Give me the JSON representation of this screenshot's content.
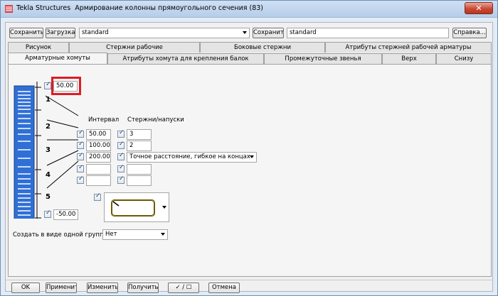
{
  "window": {
    "app_name": "Tekla Structures",
    "title": "Армирование колонны прямоугольного сечения (83)"
  },
  "toolbar": {
    "save_label": "Сохранить",
    "load_label": "Загрузка",
    "load_value": "standard",
    "save_as_label": "Сохранить как",
    "save_as_value": "standard",
    "help_label": "Справка..."
  },
  "tabs_row1": [
    "Рисунок",
    "Стержни рабочие",
    "Боковые стержни",
    "Атрибуты стержней рабочей арматуры"
  ],
  "tabs_row2": [
    "Арматурные хомуты",
    "Атрибуты хомута для крепления балок",
    "Промежуточные звенья",
    "Верх",
    "Снизу"
  ],
  "panel": {
    "top_value": "50.00",
    "interval_header": "Интервал",
    "bars_header": "Стержни/напуски",
    "rows": [
      {
        "num": "1",
        "interval": "",
        "bars": ""
      },
      {
        "num": "2",
        "interval": "50.00",
        "bars": "3"
      },
      {
        "num": "",
        "interval": "100.00",
        "bars": "2"
      },
      {
        "num": "3",
        "interval": "200.00",
        "bars": "Точное расстояние, гибкое на концах"
      },
      {
        "num": "4",
        "interval": "",
        "bars": ""
      },
      {
        "num": "5",
        "interval": "",
        "bars": ""
      }
    ],
    "bottom_value": "-50.00",
    "group_label": "Создать в виде одной группы",
    "group_value": "Нет"
  },
  "bottom": {
    "ok": "OK",
    "apply": "Применить",
    "modify": "Изменить",
    "get": "Получить",
    "toggle": "✓ / ☐",
    "cancel": "Отмена"
  },
  "colors": {
    "red_highlight": "#e01b24",
    "bar_blue": "#2f6fd6"
  }
}
